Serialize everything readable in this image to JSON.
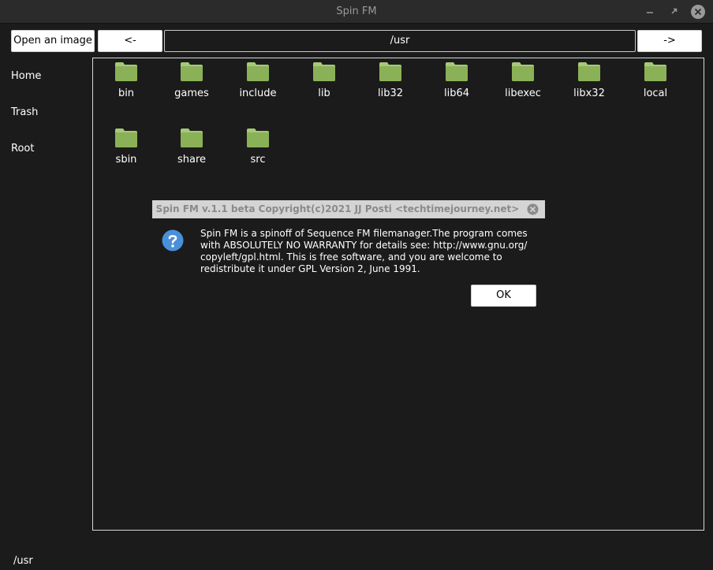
{
  "window": {
    "title": "Spin FM"
  },
  "toolbar": {
    "open_image_label": "Open an image",
    "back_label": "<-",
    "forward_label": "->",
    "path": "/usr"
  },
  "sidebar": {
    "items": [
      {
        "label": "Home"
      },
      {
        "label": "Trash"
      },
      {
        "label": "Root"
      }
    ]
  },
  "files": [
    {
      "name": "bin"
    },
    {
      "name": "games"
    },
    {
      "name": "include"
    },
    {
      "name": "lib"
    },
    {
      "name": "lib32"
    },
    {
      "name": "lib64"
    },
    {
      "name": "libexec"
    },
    {
      "name": "libx32"
    },
    {
      "name": "local"
    },
    {
      "name": "sbin"
    },
    {
      "name": "share"
    },
    {
      "name": "src"
    }
  ],
  "status": {
    "path": "/usr"
  },
  "dialog": {
    "title": "Spin FM v.1.1 beta Copyright(c)2021 JJ Posti <techtimejourney.net>",
    "message_lines": [
      "Spin FM is a spinoff of Sequence FM filemanager.The program comes",
      "with ABSOLUTELY NO WARRANTY  for details see: http://www.gnu.org/",
      "copyleft/gpl.html. This is free software, and you are welcome to",
      "redistribute it under GPL Version 2, June 1991."
    ],
    "ok_label": "OK"
  },
  "colors": {
    "background": "#1b1b1b",
    "folder": "#8bb158",
    "folder_tab": "#a6c978",
    "question_icon": "#4a90d9"
  }
}
